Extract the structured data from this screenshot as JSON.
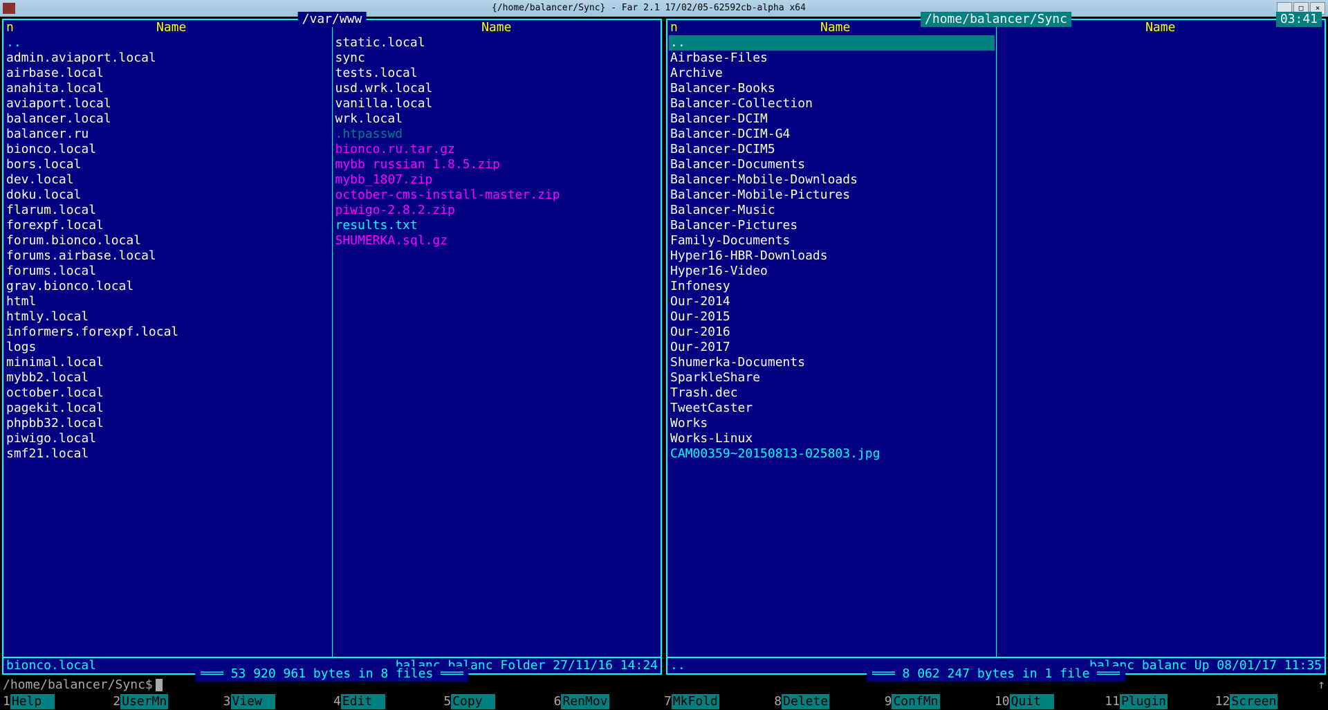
{
  "window": {
    "title": "{/home/balancer/Sync} - Far 2.1 17/02/05-62592cb-alpha x64"
  },
  "clock": "03:41",
  "left": {
    "path": "/var/www",
    "header_n": "n",
    "header_name": "Name",
    "col1": [
      {
        "name": "..",
        "cls": "updir"
      },
      {
        "name": "admin.aviaport.local",
        "cls": ""
      },
      {
        "name": "airbase.local",
        "cls": ""
      },
      {
        "name": "anahita.local",
        "cls": ""
      },
      {
        "name": "aviaport.local",
        "cls": ""
      },
      {
        "name": "balancer.local",
        "cls": ""
      },
      {
        "name": "balancer.ru",
        "cls": ""
      },
      {
        "name": "bionco.local",
        "cls": ""
      },
      {
        "name": "bors.local",
        "cls": ""
      },
      {
        "name": "dev.local",
        "cls": ""
      },
      {
        "name": "doku.local",
        "cls": ""
      },
      {
        "name": "flarum.local",
        "cls": ""
      },
      {
        "name": "forexpf.local",
        "cls": ""
      },
      {
        "name": "forum.bionco.local",
        "cls": ""
      },
      {
        "name": "forums.airbase.local",
        "cls": ""
      },
      {
        "name": "forums.local",
        "cls": ""
      },
      {
        "name": "grav.bionco.local",
        "cls": ""
      },
      {
        "name": "html",
        "cls": ""
      },
      {
        "name": "htmly.local",
        "cls": ""
      },
      {
        "name": "informers.forexpf.local",
        "cls": ""
      },
      {
        "name": "logs",
        "cls": ""
      },
      {
        "name": "minimal.local",
        "cls": ""
      },
      {
        "name": "mybb2.local",
        "cls": ""
      },
      {
        "name": "october.local",
        "cls": ""
      },
      {
        "name": "pagekit.local",
        "cls": ""
      },
      {
        "name": "phpbb32.local",
        "cls": ""
      },
      {
        "name": "piwigo.local",
        "cls": ""
      },
      {
        "name": "smf21.local",
        "cls": ""
      }
    ],
    "col2": [
      {
        "name": "static.local",
        "cls": ""
      },
      {
        "name": "sync",
        "cls": ""
      },
      {
        "name": "tests.local",
        "cls": ""
      },
      {
        "name": "usd.wrk.local",
        "cls": ""
      },
      {
        "name": "vanilla.local",
        "cls": ""
      },
      {
        "name": "wrk.local",
        "cls": ""
      },
      {
        "name": ".htpasswd",
        "cls": "hidden"
      },
      {
        "name": "bionco.ru.tar.gz",
        "cls": "archive"
      },
      {
        "name": "mybb russian 1.8.5.zip",
        "cls": "archive"
      },
      {
        "name": "mybb_1807.zip",
        "cls": "archive"
      },
      {
        "name": "october-cms-install-master.zip",
        "cls": "archive"
      },
      {
        "name": "piwigo-2.8.2.zip",
        "cls": "archive"
      },
      {
        "name": "results.txt",
        "cls": "text"
      },
      {
        "name": "SHUMERKA.sql.gz",
        "cls": "archive"
      }
    ],
    "footer_sel": "bionco.local",
    "footer_info": "balanc balanc Folder 27/11/16 14:24",
    "stats": "53 920 961 bytes in 8 files"
  },
  "right": {
    "path": "/home/balancer/Sync",
    "header_n": "n",
    "header_name": "Name",
    "col1": [
      {
        "name": "..",
        "cls": "selected"
      },
      {
        "name": "Airbase-Files",
        "cls": ""
      },
      {
        "name": "Archive",
        "cls": ""
      },
      {
        "name": "Balancer-Books",
        "cls": ""
      },
      {
        "name": "Balancer-Collection",
        "cls": ""
      },
      {
        "name": "Balancer-DCIM",
        "cls": ""
      },
      {
        "name": "Balancer-DCIM-G4",
        "cls": ""
      },
      {
        "name": "Balancer-DCIM5",
        "cls": ""
      },
      {
        "name": "Balancer-Documents",
        "cls": ""
      },
      {
        "name": "Balancer-Mobile-Downloads",
        "cls": ""
      },
      {
        "name": "Balancer-Mobile-Pictures",
        "cls": ""
      },
      {
        "name": "Balancer-Music",
        "cls": ""
      },
      {
        "name": "Balancer-Pictures",
        "cls": ""
      },
      {
        "name": "Family-Documents",
        "cls": ""
      },
      {
        "name": "Hyper16-HBR-Downloads",
        "cls": ""
      },
      {
        "name": "Hyper16-Video",
        "cls": ""
      },
      {
        "name": "Infonesy",
        "cls": ""
      },
      {
        "name": "Our-2014",
        "cls": ""
      },
      {
        "name": "Our-2015",
        "cls": ""
      },
      {
        "name": "Our-2016",
        "cls": ""
      },
      {
        "name": "Our-2017",
        "cls": ""
      },
      {
        "name": "Shumerka-Documents",
        "cls": ""
      },
      {
        "name": "SparkleShare",
        "cls": ""
      },
      {
        "name": "Trash.dec",
        "cls": ""
      },
      {
        "name": "TweetCaster",
        "cls": ""
      },
      {
        "name": "Works",
        "cls": ""
      },
      {
        "name": "Works-Linux",
        "cls": ""
      },
      {
        "name": "CAM00359~20150813-025803.jpg",
        "cls": "text"
      }
    ],
    "col2": [],
    "footer_sel": "..",
    "footer_info": "balanc balanc   Up   08/01/17 11:35",
    "stats": "8 062 247 bytes in 1 file"
  },
  "cmdline": "/home/balancer/Sync$",
  "keybar": [
    {
      "num": "1",
      "label": "Help"
    },
    {
      "num": "2",
      "label": "UserMn"
    },
    {
      "num": "3",
      "label": "View"
    },
    {
      "num": "4",
      "label": "Edit"
    },
    {
      "num": "5",
      "label": "Copy"
    },
    {
      "num": "6",
      "label": "RenMov"
    },
    {
      "num": "7",
      "label": "MkFold"
    },
    {
      "num": "8",
      "label": "Delete"
    },
    {
      "num": "9",
      "label": "ConfMn"
    },
    {
      "num": "10",
      "label": "Quit"
    },
    {
      "num": "11",
      "label": "Plugin"
    },
    {
      "num": "12",
      "label": "Screen"
    }
  ]
}
